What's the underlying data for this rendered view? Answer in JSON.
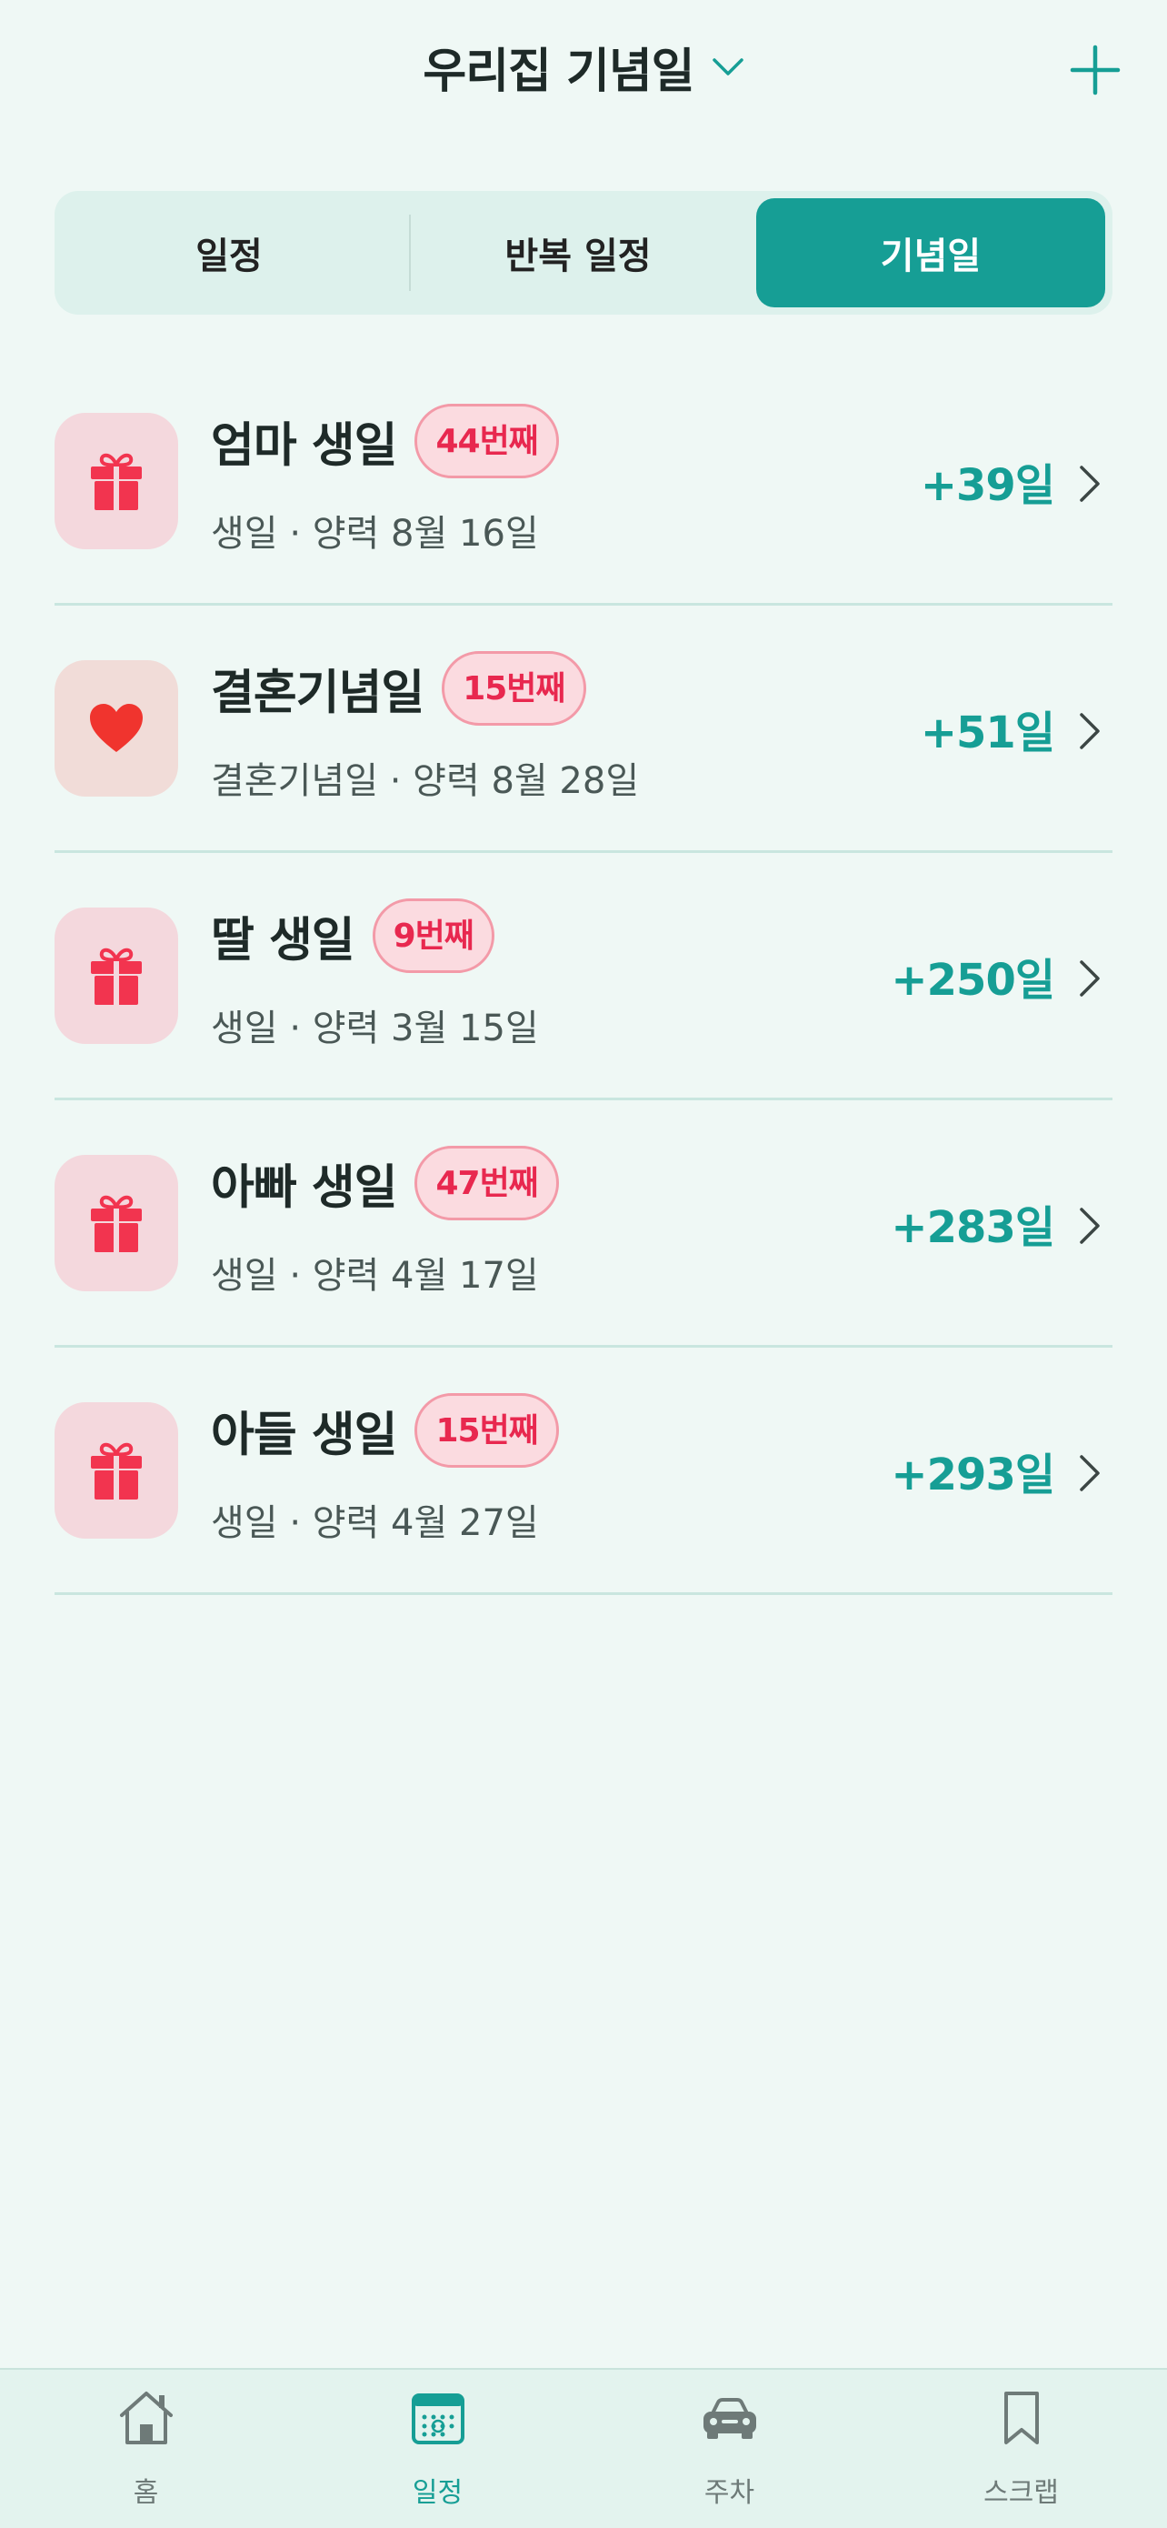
{
  "header": {
    "title": "우리집 기념일"
  },
  "tabs": [
    {
      "label": "일정"
    },
    {
      "label": "반복 일정"
    },
    {
      "label": "기념일"
    }
  ],
  "active_tab": "기념일",
  "events": [
    {
      "icon": "gift-icon",
      "name": "엄마 생일",
      "badge": "44번째",
      "subtitle": "생일 · 양력 8월 16일",
      "dday": "+39일"
    },
    {
      "icon": "heart-icon",
      "name": "결혼기념일",
      "badge": "15번째",
      "subtitle": "결혼기념일 · 양력 8월 28일",
      "dday": "+51일"
    },
    {
      "icon": "gift-icon",
      "name": "딸 생일",
      "badge": "9번째",
      "subtitle": "생일 · 양력 3월 15일",
      "dday": "+250일"
    },
    {
      "icon": "gift-icon",
      "name": "아빠 생일",
      "badge": "47번째",
      "subtitle": "생일 · 양력 4월 17일",
      "dday": "+283일"
    },
    {
      "icon": "gift-icon",
      "name": "아들 생일",
      "badge": "15번째",
      "subtitle": "생일 · 양력 4월 27일",
      "dday": "+293일"
    }
  ],
  "nav": [
    {
      "label": "홈",
      "icon": "home-icon"
    },
    {
      "label": "일정",
      "icon": "calendar-icon"
    },
    {
      "label": "주차",
      "icon": "car-icon"
    },
    {
      "label": "스크랩",
      "icon": "bookmark-icon"
    }
  ],
  "active_nav": "일정",
  "colors": {
    "accent": "#169e95",
    "badge_text": "#e8284f",
    "gift": "#f2344f",
    "heart": "#f0342e"
  }
}
